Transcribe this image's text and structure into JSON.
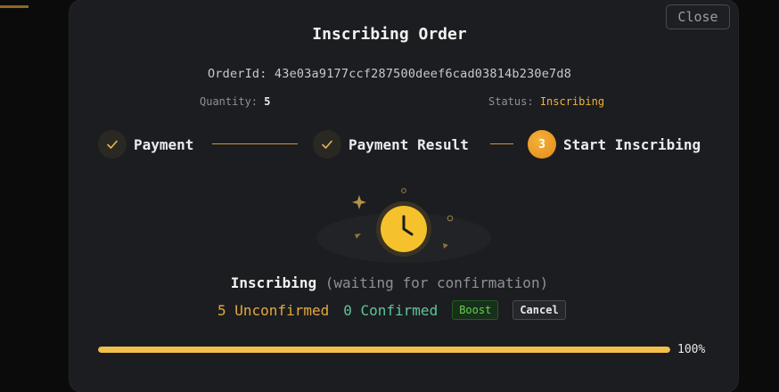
{
  "modal": {
    "title": "Inscribing Order",
    "close_label": "Close",
    "order_id_label": "OrderId:",
    "order_id": "43e03a9177ccf287500deef6cad03814b230e7d8",
    "quantity_label": "Quantity:",
    "quantity": "5",
    "status_label": "Status:",
    "status": "Inscribing"
  },
  "steps": [
    {
      "label": "Payment",
      "state": "done",
      "icon": "check-icon"
    },
    {
      "label": "Payment Result",
      "state": "done",
      "icon": "check-icon"
    },
    {
      "label": "Start Inscribing",
      "state": "active",
      "number": "3"
    }
  ],
  "progress_status": {
    "title": "Inscribing",
    "subtitle": "(waiting for confirmation)",
    "unconfirmed": "5 Unconfirmed",
    "confirmed": "0 Confirmed",
    "boost_label": "Boost",
    "cancel_label": "Cancel"
  },
  "progress": {
    "percent": 100,
    "label": "100%"
  },
  "colors": {
    "accent": "#f2bf4a",
    "status_gold": "#f0b23a",
    "confirmed_green": "#5fc49a",
    "boost_green": "#65d14e"
  },
  "illustration": {
    "icon": "clock-icon"
  }
}
